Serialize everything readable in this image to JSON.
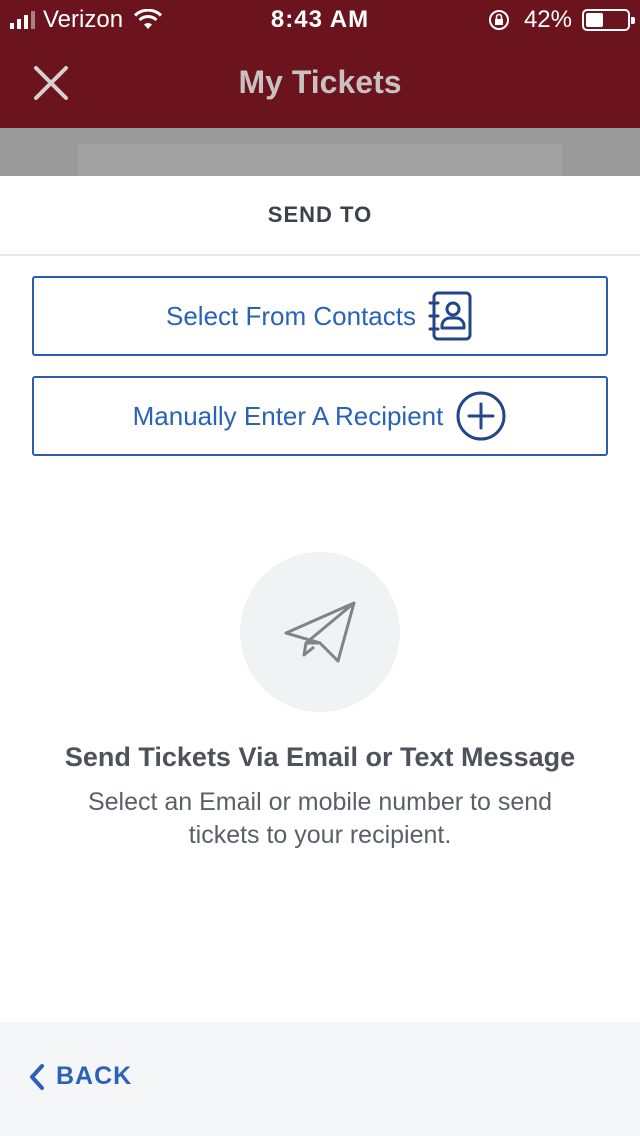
{
  "status_bar": {
    "carrier": "Verizon",
    "time": "8:43 AM",
    "battery_percent": "42%",
    "battery_level": 0.42
  },
  "nav": {
    "title": "My Tickets",
    "close_icon": "close-icon"
  },
  "sheet": {
    "title": "SEND TO",
    "select_contacts_label": "Select From Contacts",
    "select_contacts_icon": "contacts-book-icon",
    "manual_entry_label": "Manually Enter A Recipient",
    "manual_entry_icon": "plus-circle-icon",
    "empty_icon": "paper-plane-icon",
    "empty_title": "Send Tickets Via Email or Text Message",
    "empty_description": "Select an Email or mobile number to send tickets to your recipient."
  },
  "footer": {
    "back_label": "BACK",
    "back_icon": "chevron-left-icon"
  },
  "colors": {
    "header_bg": "#6b141d",
    "accent_blue": "#2a62b9",
    "title_text": "#4e525a"
  }
}
